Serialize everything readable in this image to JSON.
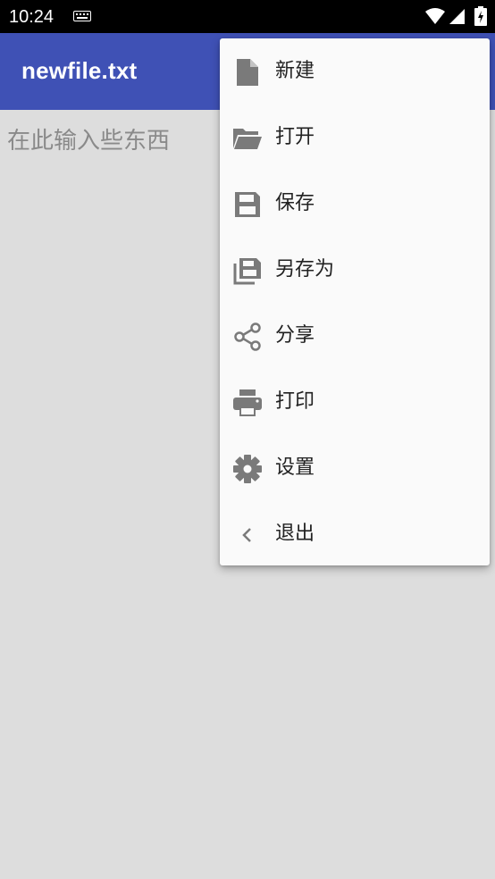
{
  "status_bar": {
    "time": "10:24"
  },
  "app_bar": {
    "title": "newfile.txt"
  },
  "editor": {
    "placeholder": "在此输入些东西"
  },
  "menu": {
    "items": [
      {
        "label": "新建",
        "icon": "new-file-icon"
      },
      {
        "label": "打开",
        "icon": "folder-open-icon"
      },
      {
        "label": "保存",
        "icon": "save-icon"
      },
      {
        "label": "另存为",
        "icon": "save-as-icon"
      },
      {
        "label": "分享",
        "icon": "share-icon"
      },
      {
        "label": "打印",
        "icon": "print-icon"
      },
      {
        "label": "设置",
        "icon": "gear-icon"
      },
      {
        "label": "退出",
        "icon": "chevron-left-icon"
      }
    ]
  },
  "colors": {
    "primary": "#3f51b5",
    "icon_gray": "#7a7a7a"
  }
}
